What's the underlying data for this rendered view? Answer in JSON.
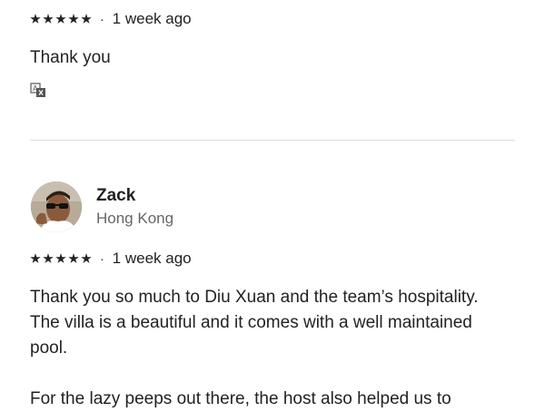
{
  "review1": {
    "rating": 5,
    "date": "1 week ago",
    "text": "Thank you",
    "translate_icon": "translate-icon"
  },
  "review2": {
    "reviewer_name": "Zack",
    "reviewer_location": "Hong Kong",
    "rating": 5,
    "date": "1 week ago",
    "text_line1": "Thank you so much to Diu Xuan and the team’s hospitality.",
    "text_line2": "The villa is a beautiful and it comes with a well maintained",
    "text_line3": "pool.",
    "text_line4": "For the lazy peeps out there, the host also helped us to"
  },
  "separator": "·"
}
